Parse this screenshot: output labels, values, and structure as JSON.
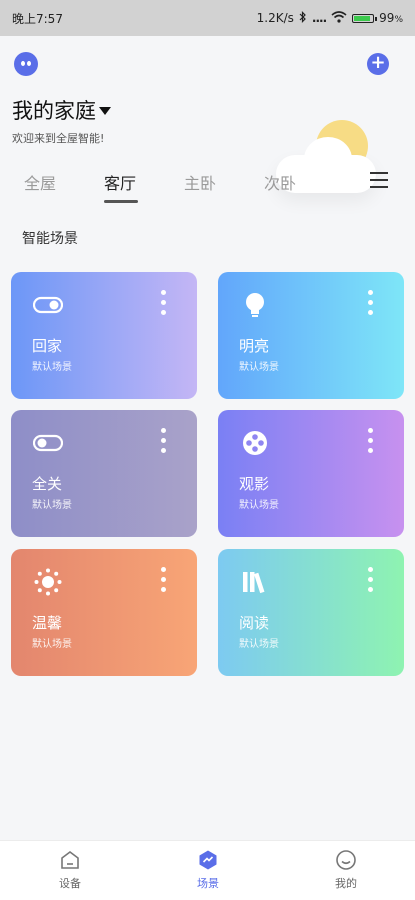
{
  "status_bar": {
    "time": "晚上7:57",
    "network_speed": "1.2K/s",
    "signal_dots": "....",
    "battery_text": "99",
    "battery_color": "#3cc94d"
  },
  "header": {
    "home_title": "我的家庭",
    "welcome_text": "欢迎来到全屋智能!",
    "add_icon": "plus-icon",
    "logo_icon": "robot-face-icon",
    "weather_icon": "partly-cloudy-icon"
  },
  "tabs": [
    {
      "label": "全屋",
      "active": false
    },
    {
      "label": "客厅",
      "active": true
    },
    {
      "label": "主卧",
      "active": false
    },
    {
      "label": "次卧",
      "active": false
    }
  ],
  "section_title": "智能场景",
  "scenes": [
    {
      "name": "回家",
      "subtitle": "默认场景",
      "icon": "toggle-on-icon"
    },
    {
      "name": "明亮",
      "subtitle": "默认场景",
      "icon": "lightbulb-icon"
    },
    {
      "name": "全关",
      "subtitle": "默认场景",
      "icon": "toggle-off-icon"
    },
    {
      "name": "观影",
      "subtitle": "默认场景",
      "icon": "film-reel-icon"
    },
    {
      "name": "温馨",
      "subtitle": "默认场景",
      "icon": "sun-icon"
    },
    {
      "name": "阅读",
      "subtitle": "默认场景",
      "icon": "books-icon"
    }
  ],
  "bottom_nav": [
    {
      "label": "设备",
      "icon": "home-icon",
      "active": false
    },
    {
      "label": "场景",
      "icon": "scene-icon",
      "active": true
    },
    {
      "label": "我的",
      "icon": "smile-icon",
      "active": false
    }
  ],
  "colors": {
    "accent": "#5a6ee8"
  }
}
